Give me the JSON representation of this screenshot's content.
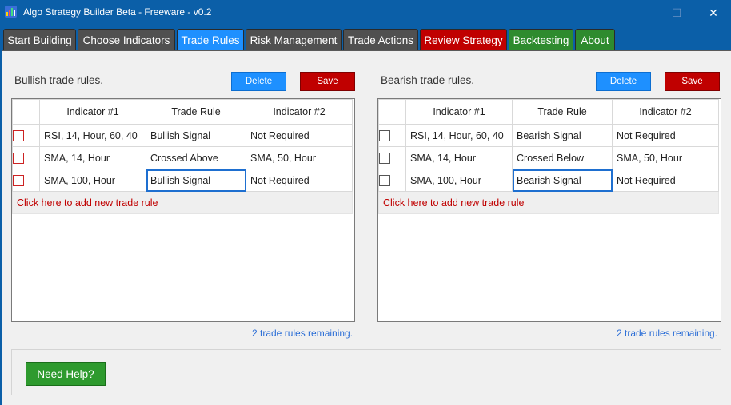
{
  "window": {
    "title": "Algo Strategy Builder Beta - Freeware - v0.2",
    "controls": {
      "minimize": "—",
      "maximize": "☐",
      "close": "✕"
    }
  },
  "tabs": [
    {
      "label": "Start Building",
      "color": "#505050"
    },
    {
      "label": "Choose Indicators",
      "color": "#505050"
    },
    {
      "label": "Trade Rules",
      "color": "#1e90ff",
      "active": true
    },
    {
      "label": "Risk Management",
      "color": "#505050"
    },
    {
      "label": "Trade Actions",
      "color": "#505050"
    },
    {
      "label": "Review Strategy",
      "color": "#c00000"
    },
    {
      "label": "Backtesting",
      "color": "#2e8b2e"
    },
    {
      "label": "About",
      "color": "#2e8b2e"
    }
  ],
  "bullish": {
    "title": "Bullish trade rules.",
    "delete_label": "Delete",
    "save_label": "Save",
    "headers": [
      "Indicator #1",
      "Trade Rule",
      "Indicator #2"
    ],
    "rows": [
      [
        "RSI, 14, Hour, 60, 40",
        "Bullish Signal",
        "Not Required"
      ],
      [
        "SMA, 14, Hour",
        "Crossed Above",
        "SMA, 50, Hour"
      ],
      [
        "SMA, 100, Hour",
        "Bullish Signal",
        "Not Required"
      ]
    ],
    "add_rule": "Click here to add new trade rule",
    "remaining": "2 trade rules remaining."
  },
  "bearish": {
    "title": "Bearish trade rules.",
    "delete_label": "Delete",
    "save_label": "Save",
    "headers": [
      "Indicator #1",
      "Trade Rule",
      "Indicator #2"
    ],
    "rows": [
      [
        "RSI, 14, Hour, 60, 40",
        "Bearish Signal",
        "Not Required"
      ],
      [
        "SMA, 14, Hour",
        "Crossed Below",
        "SMA, 50, Hour"
      ],
      [
        "SMA, 100, Hour",
        "Bearish Signal",
        "Not Required"
      ]
    ],
    "add_rule": "Click here to add new trade rule",
    "remaining": "2 trade rules remaining."
  },
  "help": {
    "label": "Need Help?"
  }
}
